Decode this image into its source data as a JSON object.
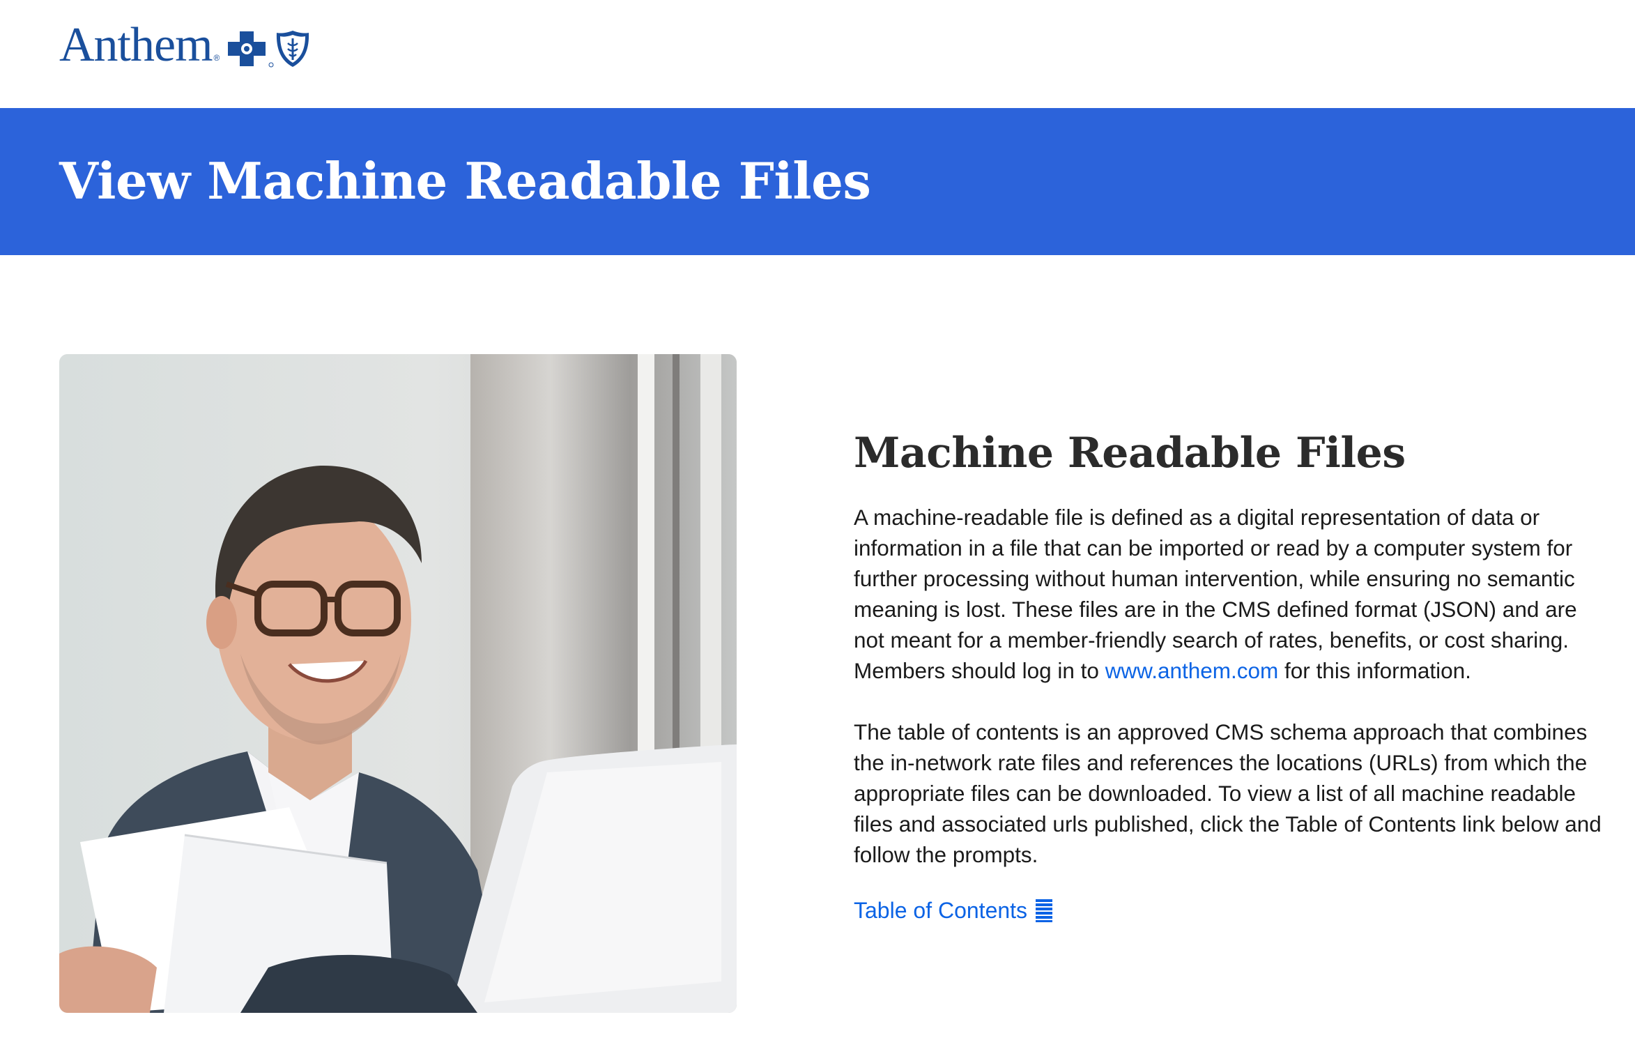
{
  "header": {
    "logo_text": "Anthem",
    "logo_reg": "®"
  },
  "banner": {
    "title": "View Machine Readable Files"
  },
  "main": {
    "title": "Machine Readable Files",
    "paragraph1": {
      "before_link": "A machine-readable file is defined as a digital representation of data or information in a file that can be imported or read by a computer system for further processing without human intervention, while ensuring no semantic meaning is lost. These files are in the CMS defined format (JSON) and are not meant for a member-friendly search of rates, benefits, or cost sharing. Members should log in to ",
      "link_text": "www.anthem.com",
      "after_link": " for this information."
    },
    "paragraph2": "The table of contents is an approved CMS schema approach that combines the in-network rate files and references the locations (URLs) from which the appropriate files can be downloaded. To view a list of all machine readable files and associated urls published, click the Table of Contents link below and follow the prompts.",
    "toc_link": "Table of Contents",
    "toc_icon": "list-icon"
  },
  "colors": {
    "brand_blue": "#1a4f9c",
    "banner_blue": "#2c63da",
    "link_blue": "#0b63e5"
  }
}
